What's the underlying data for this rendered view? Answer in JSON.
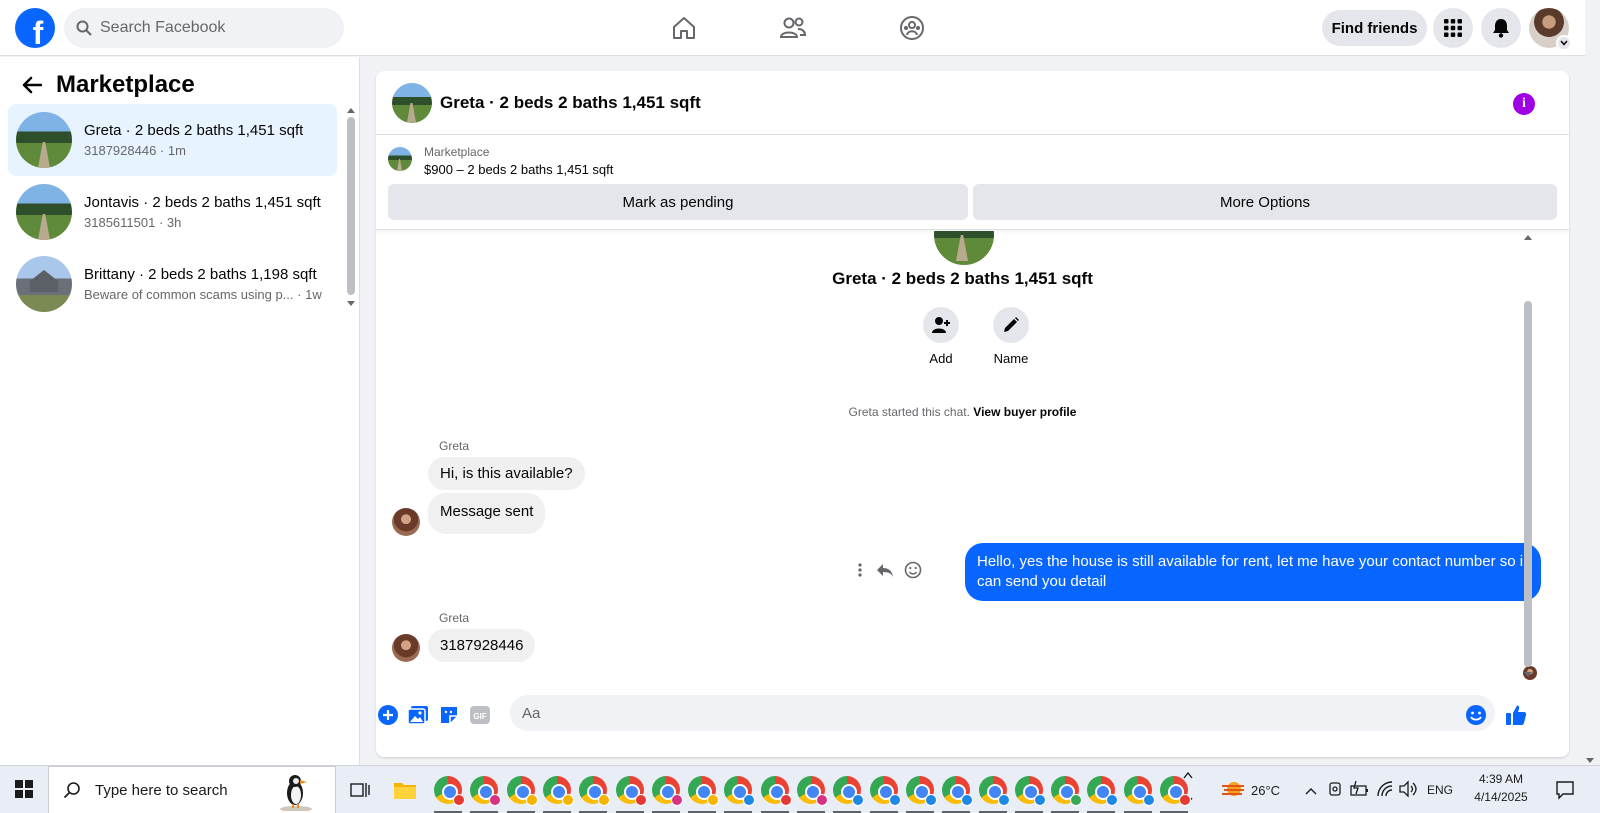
{
  "topbar": {
    "logo": "f",
    "search_placeholder": "Search Facebook",
    "find_friends": "Find friends",
    "icons": [
      "home-icon",
      "friends-icon",
      "groups-icon",
      "menu-grid-icon",
      "bell-icon"
    ]
  },
  "sidebar": {
    "title": "Marketplace",
    "conversations": [
      {
        "name": "Greta · 2 beds 2 baths 1,451 sqft",
        "sub": "3187928446 · 1m",
        "active": true
      },
      {
        "name": "Jontavis · 2 beds 2 baths 1,451 sqft",
        "sub": "3185611501 · 3h",
        "active": false
      },
      {
        "name": "Brittany · 2 beds 2 baths 1,198 sqft",
        "sub": "Beware of common scams using p...  · 1w",
        "active": false
      }
    ]
  },
  "chat": {
    "title": "Greta · 2 beds 2 baths 1,451 sqft",
    "listing_label": "Marketplace",
    "listing_price": "$900 – 2 beds 2 baths 1,451 sqft",
    "mark_pending": "Mark as pending",
    "more_options": "More Options",
    "profile_name": "Greta · 2 beds 2 baths 1,451 sqft",
    "add_label": "Add",
    "name_label": "Name",
    "started_text": "Greta started this chat.",
    "view_profile": "View buyer profile",
    "messages": [
      {
        "sender": "Greta",
        "text": "Hi, is this available?"
      },
      {
        "text": "Message sent"
      },
      {
        "text": "Hello, yes the house is still available for rent, let me have your contact number so i can send you detail",
        "outgoing": true
      },
      {
        "sender": "Greta",
        "text": "3187928446"
      }
    ],
    "input_placeholder": "Aa",
    "accent_color": "#0866ff"
  },
  "taskbar": {
    "search_text": "Type here to search",
    "weather": "26°C",
    "language": "ENG",
    "time": "4:39 AM",
    "date": "4/14/2025"
  }
}
